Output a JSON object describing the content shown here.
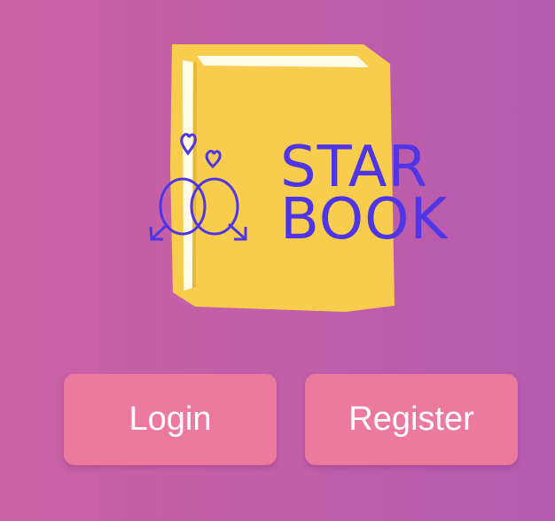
{
  "logo": {
    "line1": "STAR",
    "line2": "BOOK",
    "emblem_icon": "interlocked-rings-with-hearts-icon",
    "book_icon": "yellow-book-icon"
  },
  "buttons": {
    "login_label": "Login",
    "register_label": "Register"
  },
  "colors": {
    "background": "#c05ea9",
    "button": "#ec7a9f",
    "button_text": "#ffffff",
    "book": "#f8cd4d",
    "logo_ink": "#4e36e6"
  }
}
